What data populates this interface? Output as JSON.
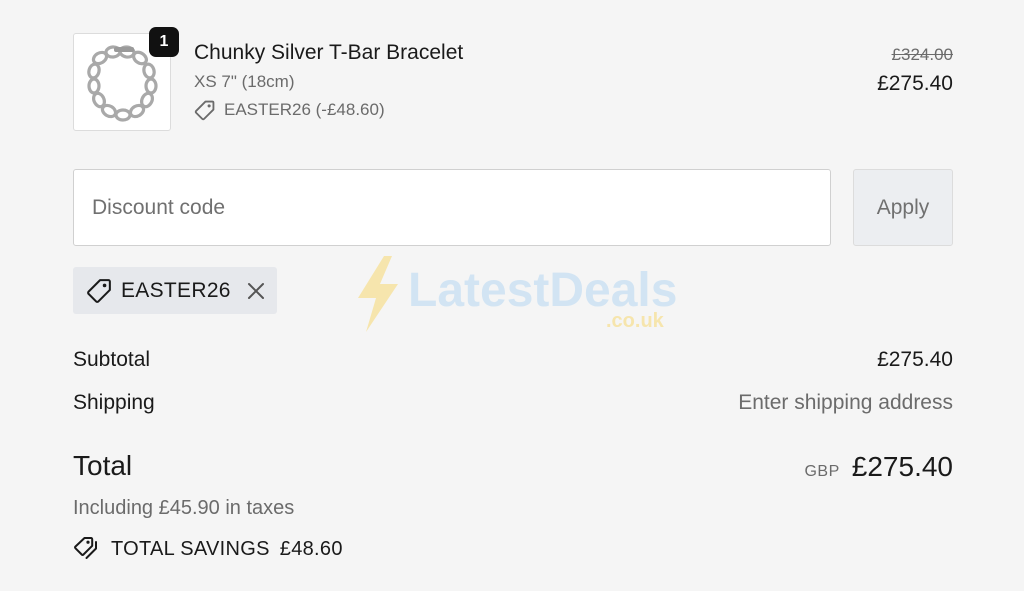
{
  "cart_item": {
    "quantity": "1",
    "name": "Chunky Silver T-Bar Bracelet",
    "variant": "XS 7\" (18cm)",
    "discount": "EASTER26 (-£48.60)",
    "original_price": "£324.00",
    "price": "£275.40",
    "image_icon": "bracelet-image"
  },
  "discount_form": {
    "placeholder": "Discount code",
    "apply_label": "Apply"
  },
  "applied_code": {
    "label": "EASTER26"
  },
  "summary": {
    "subtotal_label": "Subtotal",
    "subtotal_value": "£275.40",
    "shipping_label": "Shipping",
    "shipping_value": "Enter shipping address",
    "total_label": "Total",
    "currency": "GBP",
    "total_value": "£275.40",
    "taxes": "Including £45.90 in taxes",
    "savings_label": "TOTAL SAVINGS",
    "savings_value": "£48.60"
  },
  "watermark": {
    "brand": "LatestDeals",
    "suffix": ".co.uk"
  },
  "colors": {
    "background": "#f5f5f5",
    "text": "#1a1a1a",
    "muted": "#6b6b6b",
    "badge": "#111111",
    "watermark_blue": "#cfe3f3",
    "watermark_yellow": "#f7e4a6"
  }
}
